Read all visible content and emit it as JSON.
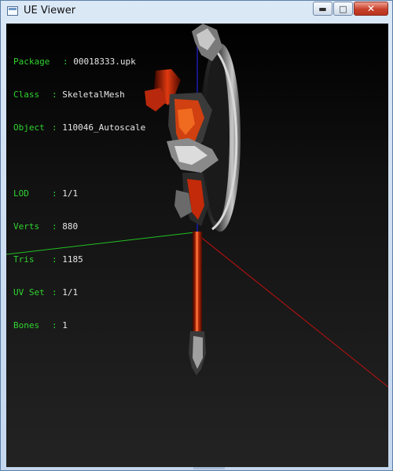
{
  "window": {
    "title": "UE Viewer",
    "controls": {
      "minimize_icon": "minimize-icon",
      "maximize_icon": "maximize-icon",
      "close_icon": "close-icon"
    }
  },
  "info": {
    "package": {
      "key": "Package",
      "value": "00018333.upk"
    },
    "class": {
      "key": "Class",
      "value": "SkeletalMesh"
    },
    "object": {
      "key": "Object",
      "value": "110046_Autoscale"
    },
    "lod": {
      "key": "LOD",
      "value": "1/1"
    },
    "verts": {
      "key": "Verts",
      "value": "880"
    },
    "tris": {
      "key": "Tris",
      "value": "1185"
    },
    "uvset": {
      "key": "UV Set",
      "value": "1/1"
    },
    "bones": {
      "key": "Bones",
      "value": "1"
    }
  },
  "colors": {
    "label": "#2fd32f",
    "value": "#e6e6e6",
    "axis_x": "#c01010",
    "axis_y": "#22c022",
    "axis_z": "#1a1ab0"
  }
}
